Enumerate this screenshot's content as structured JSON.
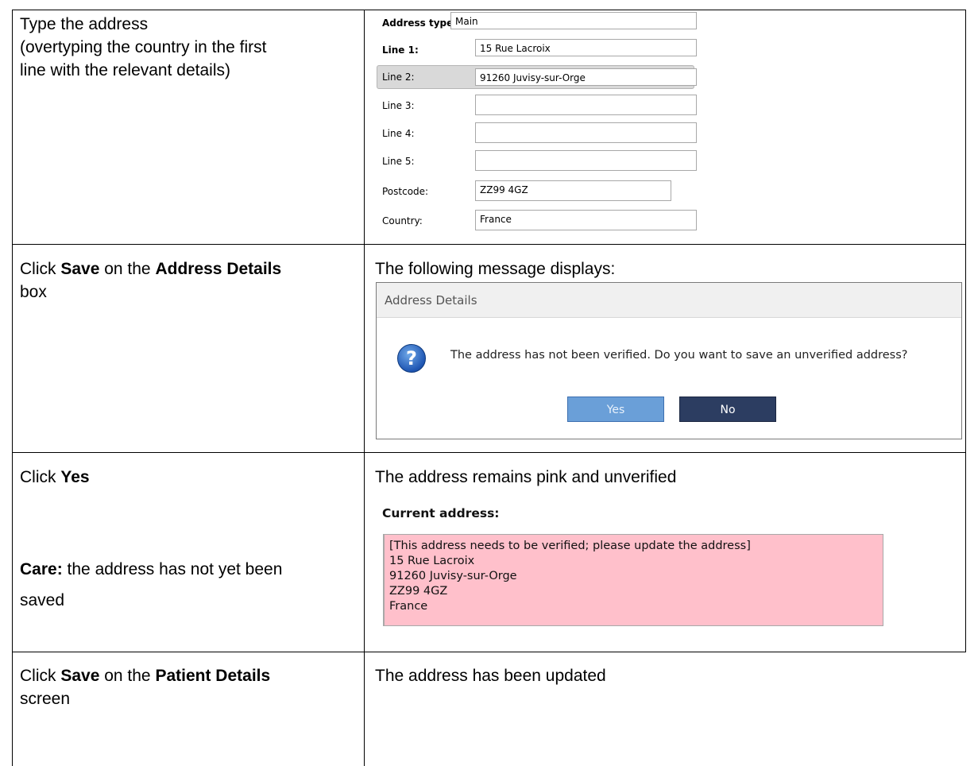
{
  "rows": [
    {
      "instruction_lines": [
        "Type the address",
        "(overtyping the country in the first",
        "line with the relevant details)"
      ]
    },
    {
      "instruction_prefix": "Click ",
      "instruction_bold1": "Save",
      "instruction_mid": " on the ",
      "instruction_bold2": "Address Details",
      "instruction_line2": "box",
      "result": "The following message displays:"
    },
    {
      "instruction_bold1": "Click ",
      "instruction_bold1b": "Yes",
      "care_bold": "Care:",
      "care_rest": " the address has not yet been",
      "care_line2": "saved",
      "result": "The address remains pink and unverified"
    },
    {
      "instruction_prefix": "Click ",
      "instruction_bold1": "Save",
      "instruction_mid": " on the ",
      "instruction_bold2": "Patient Details",
      "instruction_line2": "screen",
      "result": "The address has been updated"
    }
  ],
  "address_form": {
    "address_type_label": "Address type:",
    "address_type_value": "Main",
    "line1_label": "Line 1:",
    "line1_value": "15 Rue Lacroix",
    "line2_label": "Line 2:",
    "line2_value": "91260 Juvisy-sur-Orge",
    "line3_label": "Line 3:",
    "line3_value": "",
    "line4_label": "Line 4:",
    "line4_value": "",
    "line5_label": "Line 5:",
    "line5_value": "",
    "postcode_label": "Postcode:",
    "postcode_value": "ZZ99 4GZ",
    "country_label": "Country:",
    "country_value": "France"
  },
  "dialog": {
    "title": "Address Details",
    "icon": "question-icon",
    "message": "The address has not been verified. Do you want to save an unverified address?",
    "yes_label": "Yes",
    "no_label": "No"
  },
  "current_address": {
    "heading": "Current address:",
    "lines": [
      "[This address needs to be verified; please update the address]",
      "15 Rue Lacroix",
      "91260 Juvisy-sur-Orge",
      "ZZ99 4GZ",
      "France"
    ],
    "background_color": "#ffc0cb"
  }
}
